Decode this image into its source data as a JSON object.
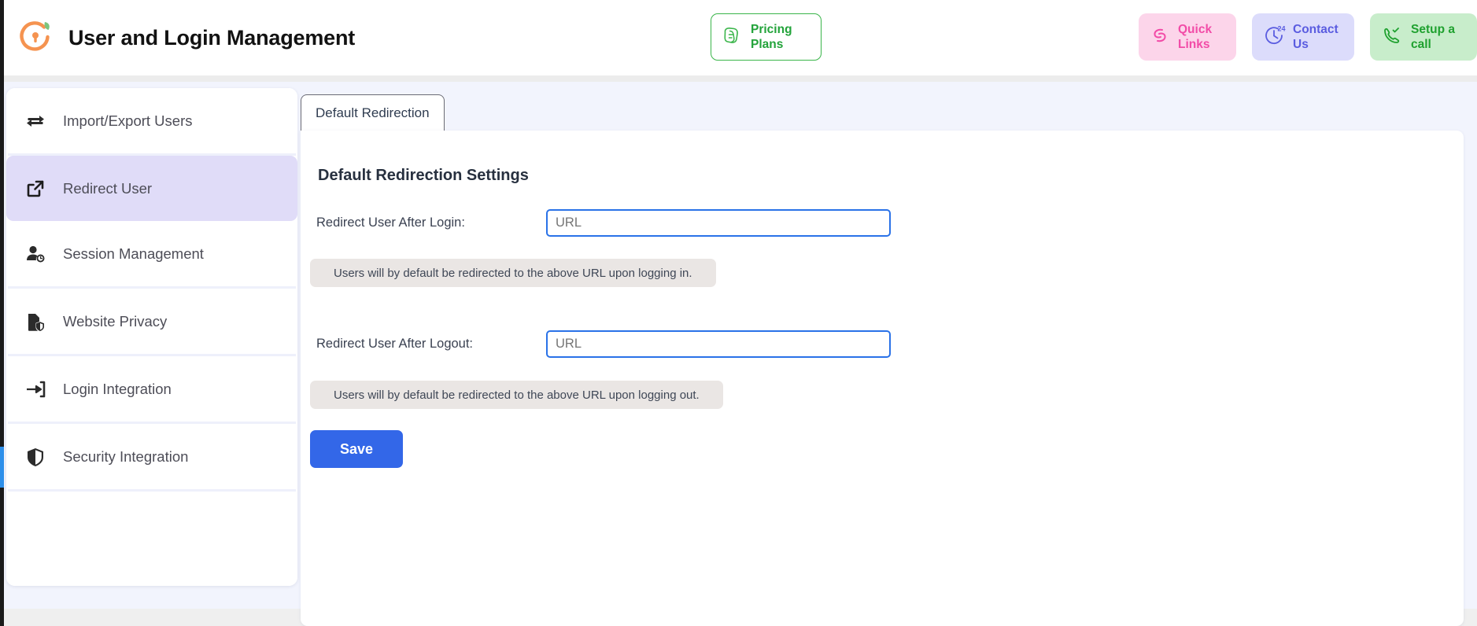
{
  "header": {
    "logo_icon": "orange-clock-lock-leaf-logo",
    "title": "User and Login Management",
    "pricing": {
      "label_line1": "Pricing",
      "label_line2": "Plans",
      "icon": "pricing-tags-icon",
      "color": "#22a33a"
    },
    "pills": [
      {
        "id": "quick-links",
        "label_line1": "Quick",
        "label_line2": "Links",
        "icon": "link-chain-icon",
        "bg": "#fcd5ea",
        "fg": "#f24ba7"
      },
      {
        "id": "contact-us",
        "label_line1": "Contact",
        "label_line2": "Us",
        "icon": "clock-24-support-icon",
        "bg": "#dcdcfb",
        "fg": "#5a5ce0"
      },
      {
        "id": "setup-a-call",
        "label_line1": "Setup a",
        "label_line2": "call",
        "icon": "phone-check-icon",
        "bg": "#c8edcb",
        "fg": "#1fa12f"
      }
    ]
  },
  "sidebar": {
    "items": [
      {
        "label": "Import/Export Users",
        "icon": "two-way-arrows-icon",
        "active": false
      },
      {
        "label": "Redirect User",
        "icon": "external-link-icon",
        "active": true
      },
      {
        "label": "Session Management",
        "icon": "user-clock-icon",
        "active": false
      },
      {
        "label": "Website Privacy",
        "icon": "file-shield-icon",
        "active": false
      },
      {
        "label": "Login Integration",
        "icon": "login-arrow-icon",
        "active": false
      },
      {
        "label": "Security Integration",
        "icon": "shield-half-icon",
        "active": false
      }
    ],
    "active_bg": "#e0dcf8"
  },
  "main": {
    "tabs": [
      {
        "label": "Default Redirection",
        "active": true
      }
    ],
    "section_title": "Default Redirection Settings",
    "fields": [
      {
        "label": "Redirect User After Login:",
        "value": "",
        "placeholder": "URL",
        "hint": "Users will by default be redirected to the above URL upon logging in."
      },
      {
        "label": "Redirect User After Logout:",
        "value": "",
        "placeholder": "URL",
        "hint": "Users will by default be redirected to the above URL upon logging out."
      }
    ],
    "save_label": "Save",
    "save_color": "#3367e8"
  }
}
